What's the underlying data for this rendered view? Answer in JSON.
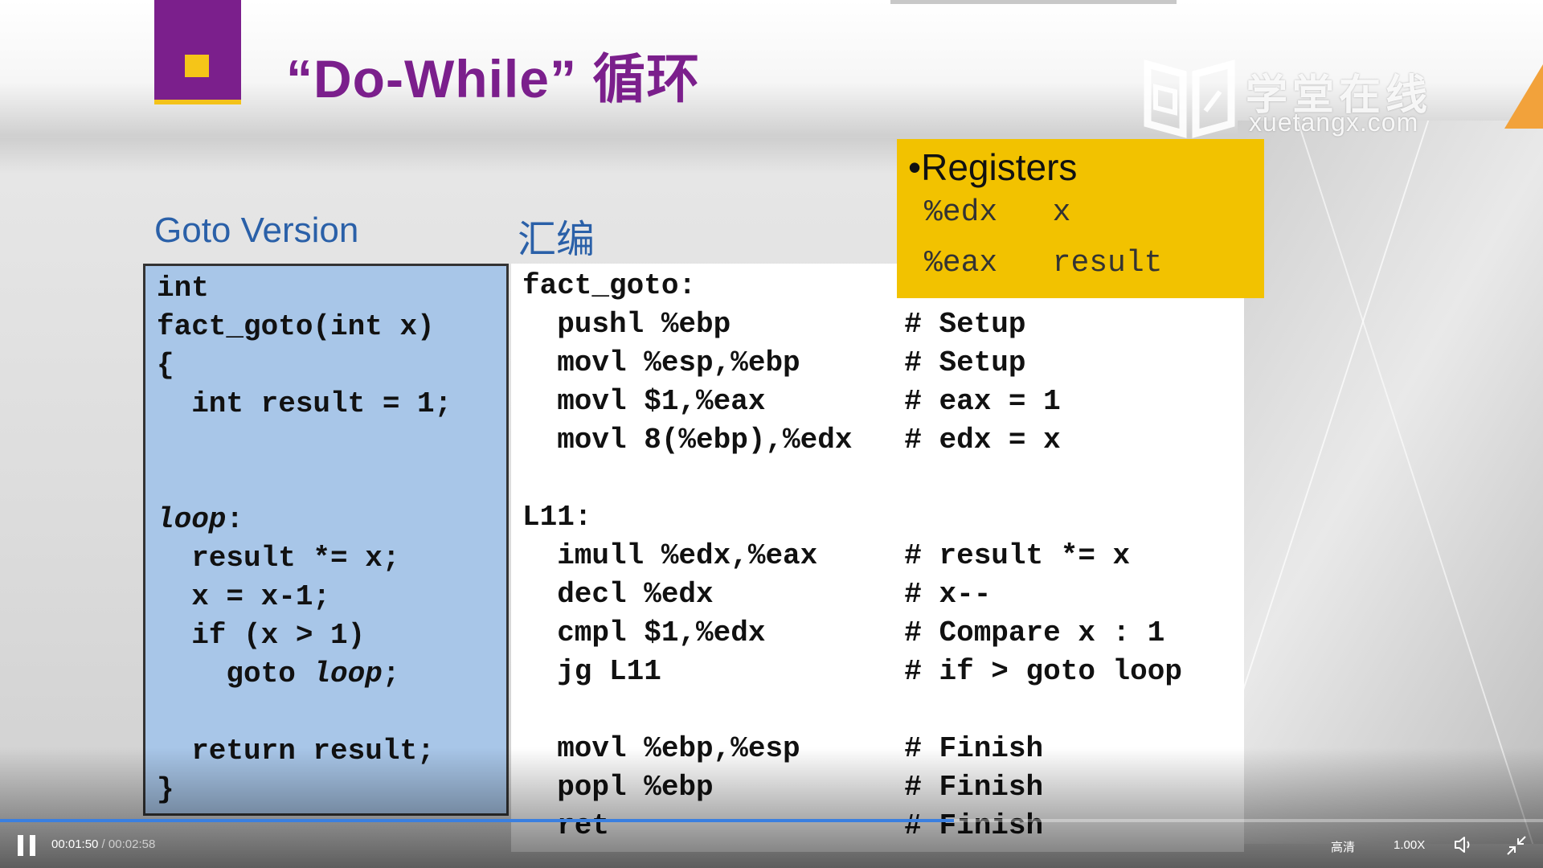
{
  "slide": {
    "title": "“Do-While” 循环",
    "watermark_cn": "学堂在线",
    "watermark_en": "xuetangx.com",
    "left_heading": "Goto Version",
    "right_heading": "汇编",
    "left_code": [
      "int",
      "fact_goto(int x)",
      "{",
      "  int result = 1;",
      "",
      "",
      "loop:",
      "  result *= x;",
      "  x = x-1;",
      "  if (x > 1)",
      "    goto loop;",
      "",
      "  return result;",
      "}"
    ],
    "right_code": [
      "fact_goto:",
      "  pushl %ebp          # Setup",
      "  movl %esp,%ebp      # Setup",
      "  movl $1,%eax        # eax = 1",
      "  movl 8(%ebp),%edx   # edx = x",
      "",
      "L11:",
      "  imull %edx,%eax     # result *= x",
      "  decl %edx           # x--",
      "  cmpl $1,%edx        # Compare x : 1",
      "  jg L11              # if > goto loop",
      "",
      "  movl %ebp,%esp      # Finish",
      "  popl %ebp           # Finish",
      "  ret                 # Finish"
    ],
    "registers": {
      "title": "•Registers",
      "rows": [
        {
          "reg": "%edx",
          "var": "x"
        },
        {
          "reg": "%eax",
          "var": "result"
        }
      ]
    }
  },
  "player": {
    "current_time": "00:01:50",
    "separator": " / ",
    "duration": "00:02:58",
    "progress": 0.618,
    "quality_label": "高清",
    "speed_label": "1.00X",
    "icons": {
      "play_pause": "pause-icon",
      "volume": "volume-icon",
      "fullscreen": "exit-fullscreen-icon"
    },
    "accent_color": "#3a7fe0"
  }
}
